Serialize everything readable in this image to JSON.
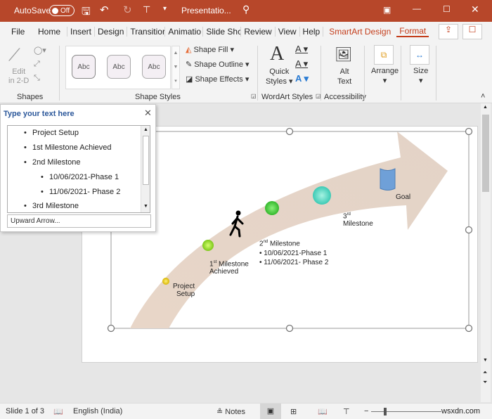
{
  "titlebar": {
    "autosave": "AutoSave",
    "toggle": "Off",
    "doc_title": "Presentatio..."
  },
  "tabs": [
    "File",
    "Home",
    "Insert",
    "Design",
    "Transitior",
    "Animatio",
    "Slide Shc",
    "Review",
    "View",
    "Help",
    "SmartArt Design",
    "Format"
  ],
  "ribbon": {
    "shapes": {
      "edit": "Edit",
      "edit2": "in 2-D",
      "label": "Shapes"
    },
    "shape_styles": {
      "samples": [
        "Abc",
        "Abc",
        "Abc"
      ],
      "fill": "Shape Fill",
      "outline": "Shape Outline",
      "effects": "Shape Effects",
      "label": "Shape Styles"
    },
    "wordart": {
      "quick": "Quick",
      "styles": "Styles",
      "label": "WordArt Styles"
    },
    "accessibility": {
      "alt": "Alt",
      "text": "Text",
      "label": "Accessibility"
    },
    "arrange": "Arrange",
    "size": "Size"
  },
  "text_pane": {
    "title": "Type your text here",
    "items": [
      {
        "text": "Project Setup",
        "level": 1
      },
      {
        "text": "1st Milestone Achieved",
        "level": 1
      },
      {
        "text": "2nd Milestone",
        "level": 1
      },
      {
        "text": "10/06/2021-Phase  1",
        "level": 2
      },
      {
        "text": "11/06/2021-  Phase 2",
        "level": 2
      },
      {
        "text": "3rd Milestone",
        "level": 1
      }
    ],
    "footer": "Upward Arrow..."
  },
  "smartart": {
    "project": [
      "Project",
      "Setup"
    ],
    "m1": [
      "1",
      "st",
      " Milestone",
      "Achieved"
    ],
    "m2": [
      "2",
      "nd",
      " Milestone"
    ],
    "m2_bullets": [
      "10/06/2021-Phase 1",
      "11/06/2021- Phase 2"
    ],
    "m3": [
      "3",
      "rd",
      "Milestone"
    ],
    "goal": "Goal"
  },
  "status": {
    "slide": "Slide 1 of 3",
    "language": "English (India)",
    "notes": "Notes",
    "watermark": "wsxdn.com"
  },
  "colors": {
    "titlebar": "#b7472a",
    "accent": "#c43e1c"
  }
}
